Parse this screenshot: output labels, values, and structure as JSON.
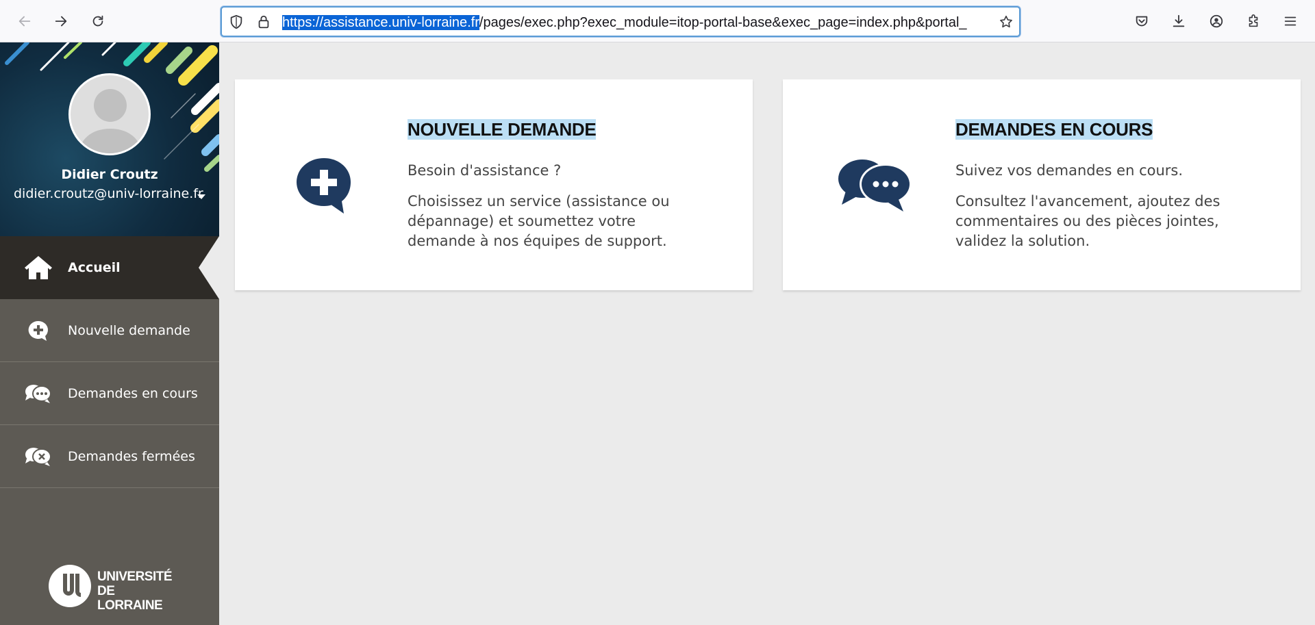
{
  "browser": {
    "url_selected": "https://assistance.univ-lorraine.fr",
    "url_rest": "/pages/exec.php?exec_module=itop-portal-base&exec_page=index.php&portal_"
  },
  "sidebar": {
    "user_name": "Didier Croutz",
    "user_email": "didier.croutz@univ-lorraine.fr",
    "items": [
      {
        "label": "Accueil",
        "icon": "home-icon",
        "active": true
      },
      {
        "label": "Nouvelle demande",
        "icon": "chat-plus-icon",
        "active": false
      },
      {
        "label": "Demandes en cours",
        "icon": "chat-ellipsis-icon",
        "active": false
      },
      {
        "label": "Demandes fermées",
        "icon": "chat-close-icon",
        "active": false
      }
    ],
    "logo_text_line1": "UNIVERSITÉ",
    "logo_text_line2": "DE LORRAINE"
  },
  "cards": [
    {
      "title": "NOUVELLE DEMANDE",
      "subtitle": "Besoin d'assistance ?",
      "description": "Choisissez un service (assistance ou dépannage) et soumettez votre demande à nos équipes de support.",
      "icon": "chat-plus-icon"
    },
    {
      "title": "DEMANDES EN COURS",
      "subtitle": "Suivez vos demandes en cours.",
      "description": "Consultez l'avancement, ajoutez des commentaires ou des pièces jointes, validez la solution.",
      "icon": "chat-ellipsis-icon"
    }
  ],
  "colors": {
    "accent_navy": "#1f3a5f",
    "sidebar_bg": "#5d5a54",
    "sidebar_active": "#2e2b27",
    "page_bg": "#ebebeb"
  }
}
